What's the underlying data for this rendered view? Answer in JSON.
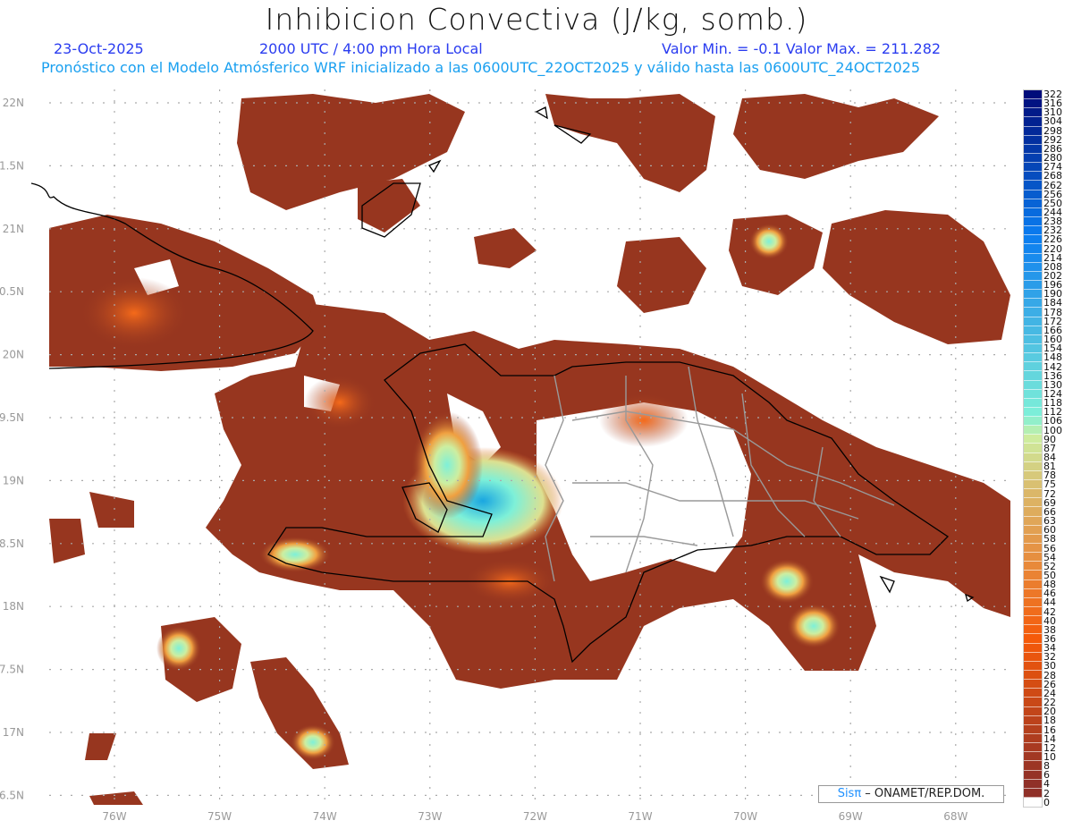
{
  "header": {
    "title": "Inhibicion Convectiva (J/kg, somb.)",
    "date": "23-Oct-2025",
    "time": "2000 UTC / 4:00 pm Hora Local",
    "minmax": "Valor Min. = -0.1  Valor Max. = 211.282",
    "forecast": "Pronóstico con el Modelo Atmósferico WRF inicializado a las 0600UTC_22OCT2025 y válido hasta las  0600UTC_24OCT2025"
  },
  "axes": {
    "lat_labels": [
      "22N",
      "1.5N",
      "21N",
      "0.5N",
      "20N",
      "9.5N",
      "19N",
      "8.5N",
      "18N",
      "7.5N",
      "17N",
      "6.5N"
    ],
    "lon_labels": [
      "76W",
      "75W",
      "74W",
      "73W",
      "72W",
      "71W",
      "70W",
      "69W",
      "68W"
    ]
  },
  "colorbar": {
    "labels": [
      "322",
      "316",
      "310",
      "304",
      "298",
      "292",
      "286",
      "280",
      "274",
      "268",
      "262",
      "256",
      "250",
      "244",
      "238",
      "232",
      "226",
      "220",
      "214",
      "208",
      "202",
      "196",
      "190",
      "184",
      "178",
      "172",
      "166",
      "160",
      "154",
      "148",
      "142",
      "136",
      "130",
      "124",
      "118",
      "112",
      "106",
      "100",
      "90",
      "87",
      "84",
      "81",
      "78",
      "75",
      "72",
      "69",
      "66",
      "63",
      "60",
      "58",
      "56",
      "54",
      "52",
      "50",
      "48",
      "46",
      "44",
      "42",
      "40",
      "38",
      "36",
      "34",
      "32",
      "30",
      "28",
      "26",
      "24",
      "22",
      "20",
      "18",
      "16",
      "14",
      "12",
      "10",
      "8",
      "6",
      "4",
      "2",
      "0"
    ],
    "colors": {
      "high": "#000c7a",
      "blue": "#0a7cf0",
      "cyan": "#7ef0d8",
      "pale": "#cdeea0",
      "tan": "#dbb86a",
      "orange": "#f55a0a",
      "brown": "#903028"
    }
  },
  "credit": {
    "brand": "Sisπ",
    "text": " – ONAMET/REP.DOM."
  }
}
